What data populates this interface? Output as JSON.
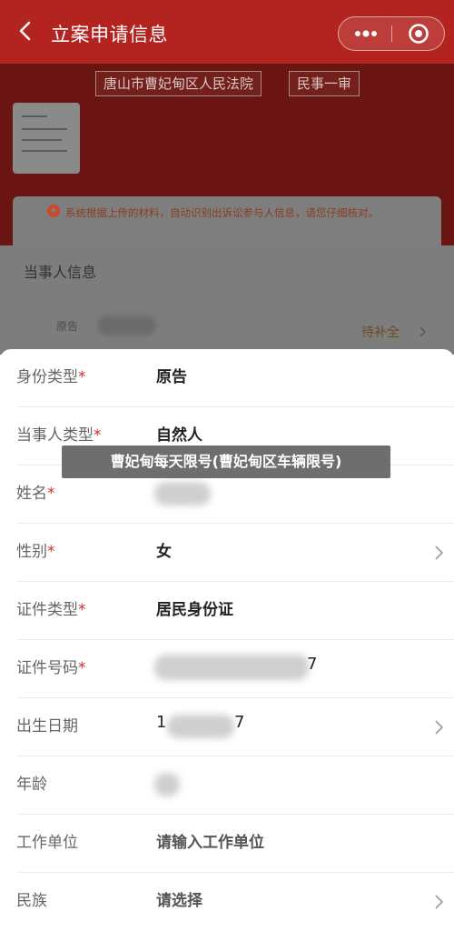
{
  "header": {
    "title": "立案申请信息",
    "back_icon": "chevron-left-icon",
    "more_icon": "more-dots-icon",
    "close_icon": "target-close-icon",
    "bar_color": "#b3231f"
  },
  "background": {
    "court_name": "唐山市曹妃甸区人民法院",
    "case_type": "民事一审",
    "notice": "系统根据上传的材料，自动识别出诉讼参与人信息，请您仔细核对。",
    "section_title": "当事人信息",
    "party_role": "原告",
    "party_status": "待补全"
  },
  "form": {
    "rows": [
      {
        "label": "身份类型",
        "required": true,
        "value": "原告"
      },
      {
        "label": "当事人类型",
        "required": true,
        "value": "自然人"
      },
      {
        "label": "姓名",
        "required": true,
        "value": ""
      },
      {
        "label": "性别",
        "required": true,
        "value": "女"
      },
      {
        "label": "证件类型",
        "required": true,
        "value": "居民身份证"
      },
      {
        "label": "证件号码",
        "required": true,
        "value": "7"
      },
      {
        "label": "出生日期",
        "required": false,
        "value_start": "1",
        "value_end": "7"
      },
      {
        "label": "年龄",
        "required": false,
        "value": ""
      },
      {
        "label": "工作单位",
        "required": false,
        "placeholder": "请输入工作单位"
      },
      {
        "label": "民族",
        "required": false,
        "placeholder": "请选择"
      }
    ],
    "required_mark": "*"
  },
  "watermark": "曹妃甸每天限号(曹妃甸区车辆限号)"
}
